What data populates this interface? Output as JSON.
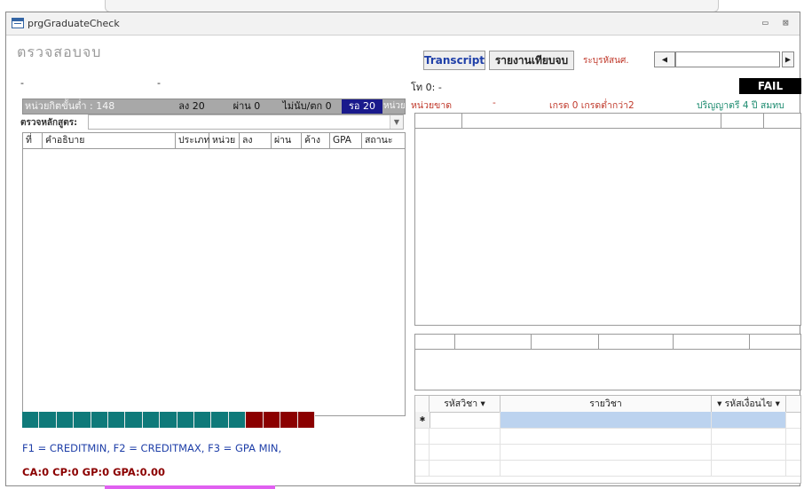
{
  "window": {
    "title": "prgGraduateCheck",
    "minimize_glyph": "▭",
    "close_glyph": "⊠"
  },
  "form": {
    "title": "ตรวจสอบจบ"
  },
  "toolbar": {
    "transcript_label": "Transcript",
    "report_label": "รายงานเทียบจบ",
    "student_id_label": "ระบุรหัสนศ.",
    "student_id_value": ""
  },
  "left": {
    "dash_left": "-",
    "dash_mid": "-",
    "status": {
      "min_credit": "หน่วยกิตขั้นต่ำ : 148",
      "enrolled": "ลง 20",
      "passed": "ผ่าน 0",
      "not_counted": "ไม่นับ/ตก 0",
      "waiting": "รอ 20",
      "unit": "หน่วย"
    },
    "curriculum_label": "ตรวจหลักสูตร:",
    "curriculum_value": "",
    "columns": [
      "ที่",
      "คำอธิบาย",
      "ประเภท",
      "หน่วย",
      "ลง",
      "ผ่าน",
      "ค้าง",
      "GPA",
      "สถานะ"
    ],
    "progress_complete": 0.77,
    "formula_text": "F1 = CREDITMIN, F2 = CREDITMAX, F3 = GPA MIN,",
    "summary_text": "CA:0  CP:0  GP:0  GPA:0.00"
  },
  "right": {
    "header_left": "โท 0: -",
    "result_badge": "FAIL",
    "missing_label": "หน่วยขาด",
    "missing_dash": "-",
    "grade_info": "เกรด 0 เกรดต่ำกว่า2",
    "degree_info": "ปริญญาตรี 4 ปี สมทบ",
    "grid": {
      "columns": [
        "รหัสวิชา",
        "รายวิชา",
        "รหัสเงื่อนไข"
      ],
      "new_row_marker": "✱"
    }
  },
  "colors": {
    "progress_done": "#0f7a7a",
    "progress_todo": "#8b0000",
    "fail_bg": "#000000",
    "waiting_bg": "#1a1a8c",
    "link_blue": "#1f3fa8",
    "accent_red": "#c0392b",
    "accent_teal": "#1a8a6e",
    "selection_cell": "#bcd3ef"
  }
}
